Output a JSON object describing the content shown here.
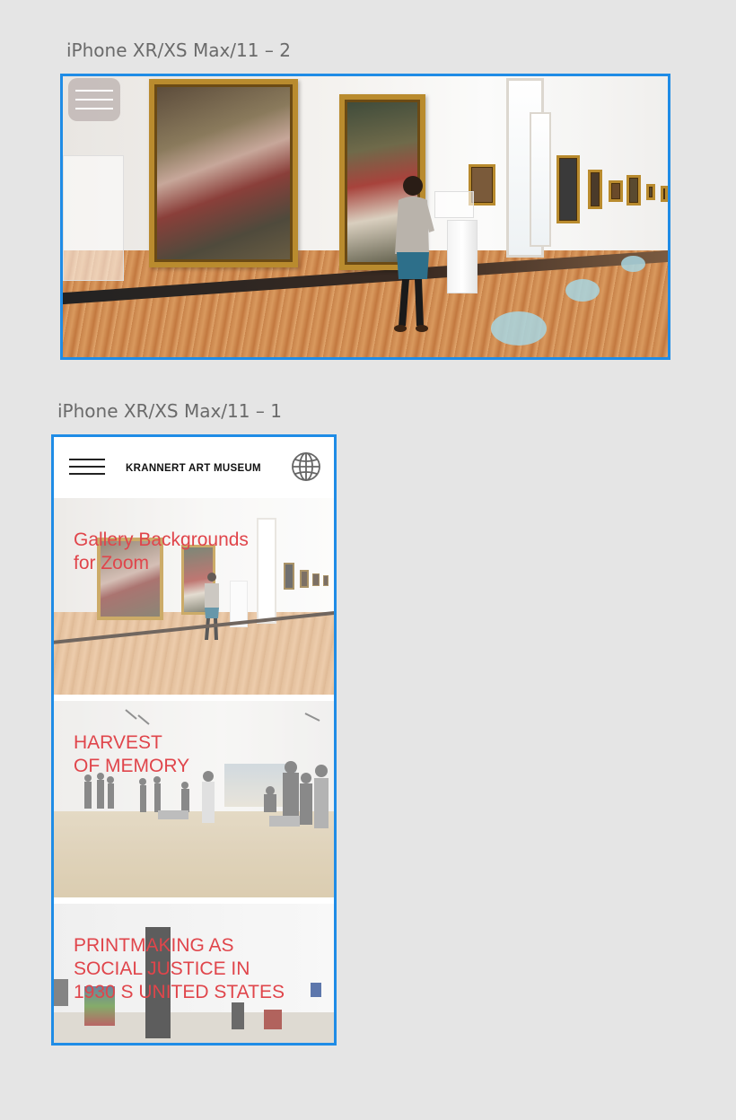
{
  "artboards": {
    "landscape": {
      "label": "iPhone XR/XS Max/11 – 2"
    },
    "portrait": {
      "label": "iPhone XR/XS Max/11 – 1"
    }
  },
  "header": {
    "title": "KRANNERT ART MUSEUM",
    "menu_icon": "hamburger-menu-icon",
    "language_icon": "globe-icon"
  },
  "features": [
    {
      "title": "Gallery Backgrounds\nfor Zoom"
    },
    {
      "title": "HARVEST\nOF MEMORY"
    },
    {
      "title": "PRINTMAKING AS\nSOCIAL JUSTICE IN\n1930 S UNITED STATES"
    }
  ],
  "colors": {
    "accent": "#e0454b",
    "selection_border": "#1f8ce6",
    "canvas": "#e5e5e5",
    "hotspot": "#a8d6e2"
  }
}
